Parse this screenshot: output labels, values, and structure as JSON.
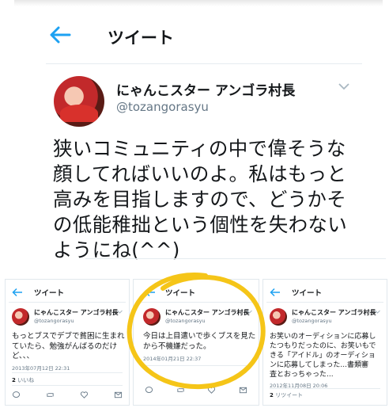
{
  "main": {
    "title": "ツイート",
    "display_name": "にゃんこスター アンゴラ村長",
    "handle": "@tozangorasyu",
    "text_lines": [
      "狭いコミュニティの中で偉そうな",
      "顔してればいいのよ。私はもっと",
      "高みを目指しますので、どうかそ",
      "の低能稚拙という個性を失わない",
      "ようにね(^^)"
    ]
  },
  "panels": [
    {
      "title": "ツイート",
      "display_name": "にゃんこスター アンゴラ村長",
      "handle": "@tozangorasyu",
      "text_lines": [
        "もっとブスでデブで貧困に生まれ",
        "ていたら、勉強がんばるのだけ",
        "ど、、、"
      ],
      "date": "2013年07月12日 22:31",
      "count": "2",
      "count_label": "いいね"
    },
    {
      "title": "ツイート",
      "display_name": "にゃんこスター アンゴラ村長",
      "handle": "@tozangorasyu",
      "text_lines": [
        "今日は上目遣いで歩くブスを見た",
        "から不機嫌だった。"
      ],
      "date": "2014年01月21日 22:37",
      "count": "",
      "count_label": ""
    },
    {
      "title": "ツイート",
      "display_name": "にゃんこスター アンゴラ村長",
      "handle": "@tozangorasyu",
      "text_lines": [
        "お笑いのオーディションに応募し",
        "たつもりだったのに、お笑いもで",
        "きる「アイドル」のオーディショ",
        "ンに応募してしまった...書類審",
        "査とおっちゃった..."
      ],
      "date": "2012年11月08日 20:06",
      "count": "2",
      "count_label": "リツイート"
    }
  ],
  "colors": {
    "accent": "#1da1f2",
    "annotation": "#f5c518",
    "muted": "#657786"
  }
}
